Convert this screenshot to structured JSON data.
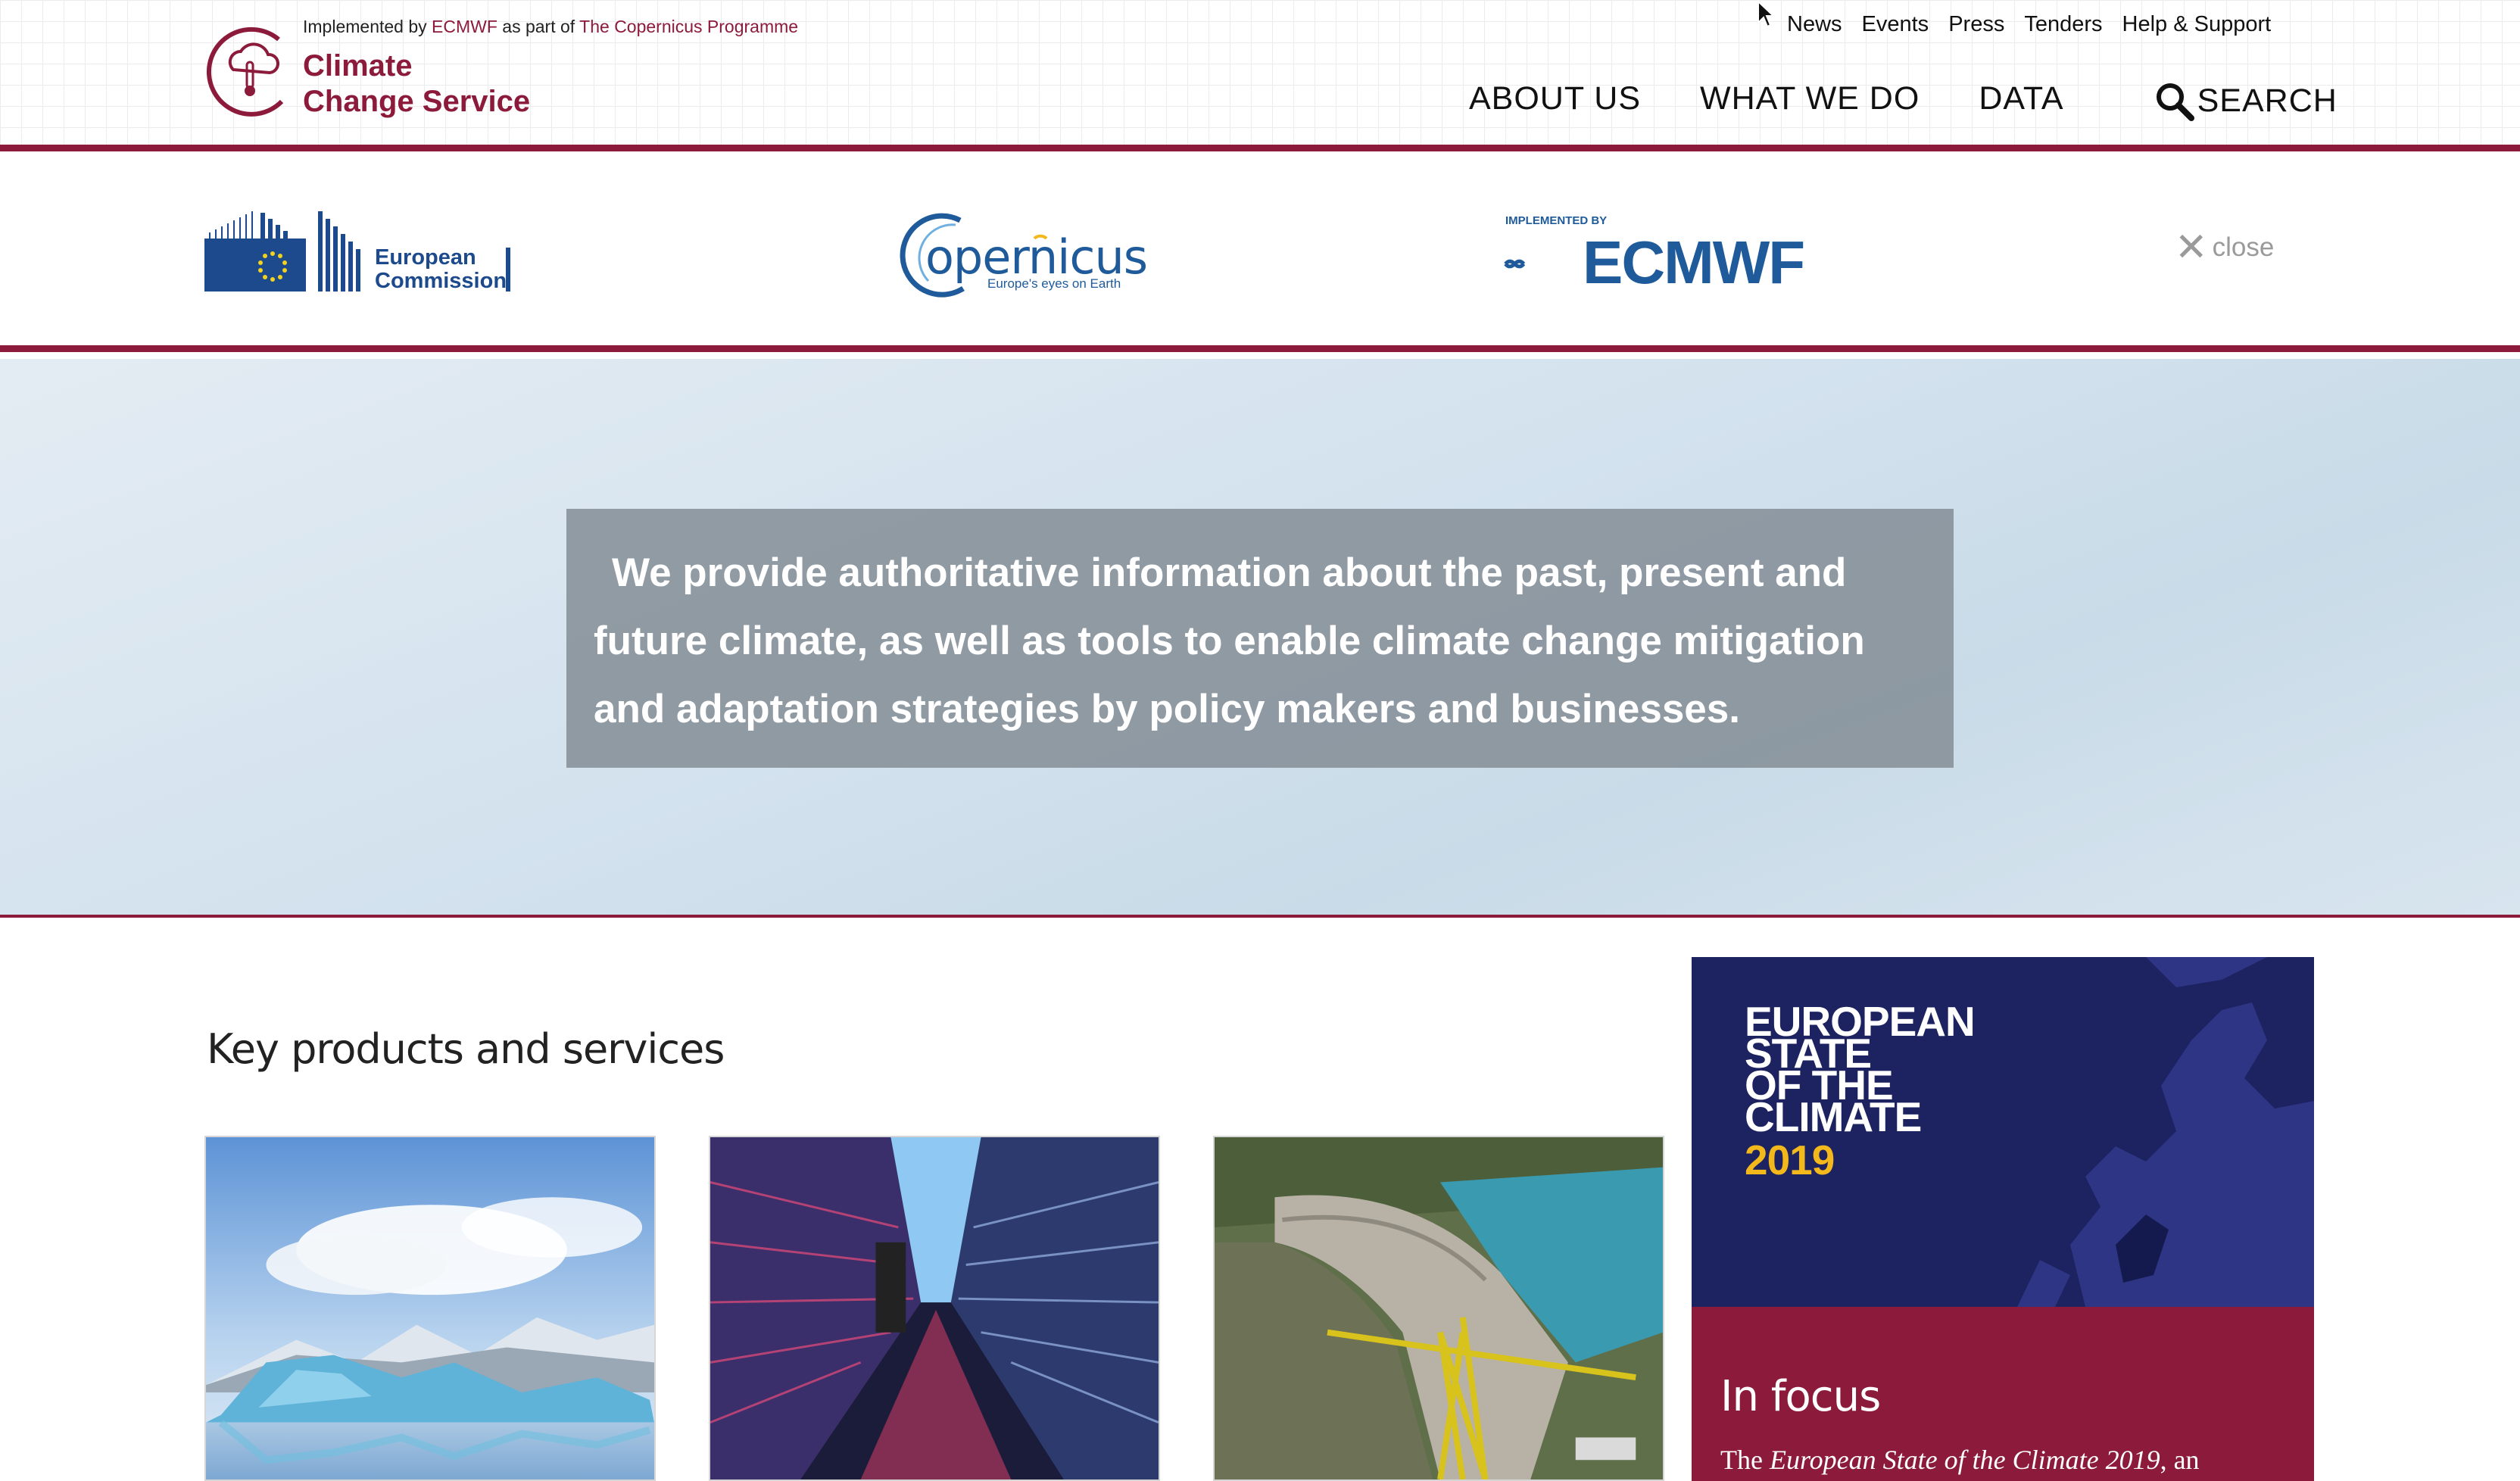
{
  "header": {
    "impl_prefix": "Implemented by",
    "impl_org": "ECMWF",
    "impl_mid": "as part of",
    "impl_programme": "The Copernicus Programme",
    "logo_line1": "Climate",
    "logo_line2": "Change Service",
    "logo_icon": "cloud-thermometer-icon"
  },
  "top_links": [
    "News",
    "Events",
    "Press",
    "Tenders",
    "Help & Support"
  ],
  "main_nav": {
    "about": "ABOUT US",
    "what": "WHAT WE DO",
    "data": "DATA",
    "search": "SEARCH",
    "search_icon": "search-icon"
  },
  "partners": {
    "ec_line1": "European",
    "ec_line2": "Commission",
    "copernicus": "opernicus",
    "copernicus_tag": "Europe's eyes on Earth",
    "ecmwf_impl": "IMPLEMENTED BY",
    "ecmwf": "ECMWF",
    "close": "close"
  },
  "hero": {
    "text": "We provide authoritative information about the past, present and future climate, as well as tools to enable climate change mitigation and adaptation strategies by policy makers and businesses."
  },
  "products": {
    "title": "Key products and services"
  },
  "focus": {
    "headline_1": "EUROPEAN",
    "headline_2": "STATE",
    "headline_3": "OF THE",
    "headline_4": "CLIMATE",
    "year": "2019",
    "label": "In focus",
    "text_prefix": "The ",
    "text_italic": "European State of the Climate 2019",
    "text_suffix": ", an"
  },
  "colors": {
    "brand": "#8c1a3b",
    "copernicus_blue": "#1f5a9a",
    "focus_navy": "#1f2358",
    "focus_yellow": "#f2b81c"
  }
}
